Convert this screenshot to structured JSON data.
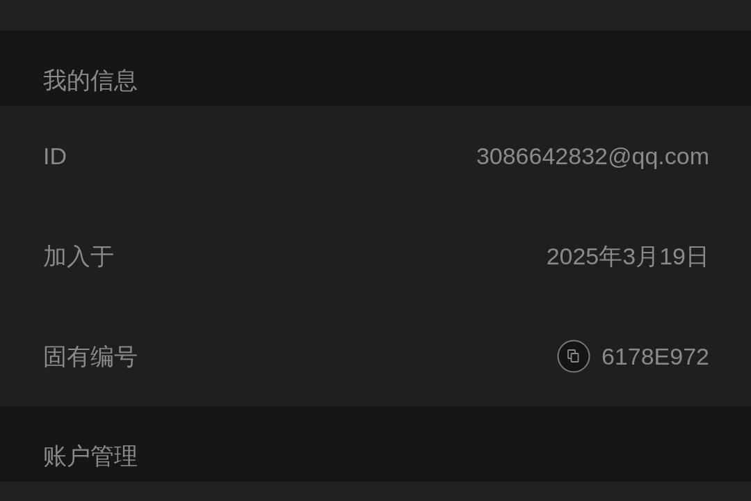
{
  "sections": [
    {
      "title": "我的信息",
      "rows": [
        {
          "kind": "text",
          "label": "ID",
          "value": "3086642832@qq.com"
        },
        {
          "kind": "text",
          "label": "加入于",
          "value": "2025年3月19日"
        },
        {
          "kind": "copy",
          "label": "固有编号",
          "value": "6178E972"
        }
      ]
    },
    {
      "title": "账户管理"
    }
  ]
}
